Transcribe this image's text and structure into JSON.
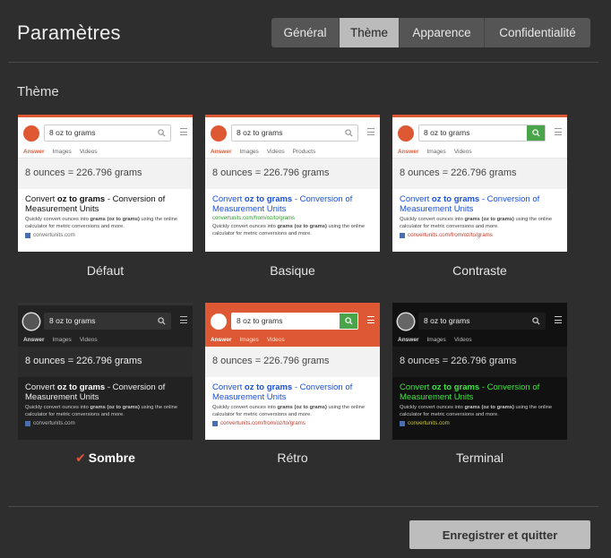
{
  "page": {
    "title": "Paramètres"
  },
  "tabs": [
    {
      "label": "Général"
    },
    {
      "label": "Thème"
    },
    {
      "label": "Apparence"
    },
    {
      "label": "Confidentialité"
    }
  ],
  "section": {
    "title": "Thème"
  },
  "preview": {
    "query": "8 oz to grams",
    "nav_answer": "Answer",
    "nav_images": "Images",
    "nav_videos": "Videos",
    "nav_products": "Products",
    "answer": "8 ounces = 226.796 grams",
    "result_title_a": "Convert ",
    "result_title_b": "oz to grams",
    "result_title_c": " - Conversion of Measurement Units",
    "green_url": "convertunits.com/from/oz/to/grams",
    "desc_a": "Quickly convert ounces into ",
    "desc_b": "grams (oz to grams)",
    "desc_c": " using the online calculator for metric conversions and more.",
    "url_short": "convertunits.com",
    "url_long": "convertunits.com/from/oz/to/grams"
  },
  "themes": [
    {
      "label": "Défaut"
    },
    {
      "label": "Basique"
    },
    {
      "label": "Contraste"
    },
    {
      "label": "Sombre",
      "selected": true
    },
    {
      "label": "Rétro"
    },
    {
      "label": "Terminal"
    }
  ],
  "save_label": "Enregistrer et quitter",
  "colors": {
    "background": "#2e2e2e",
    "accent": "#de5833",
    "link_blue": "#1a4fd9",
    "terminal_green": "#3ee43e",
    "contrast_green": "#4aa54a"
  }
}
